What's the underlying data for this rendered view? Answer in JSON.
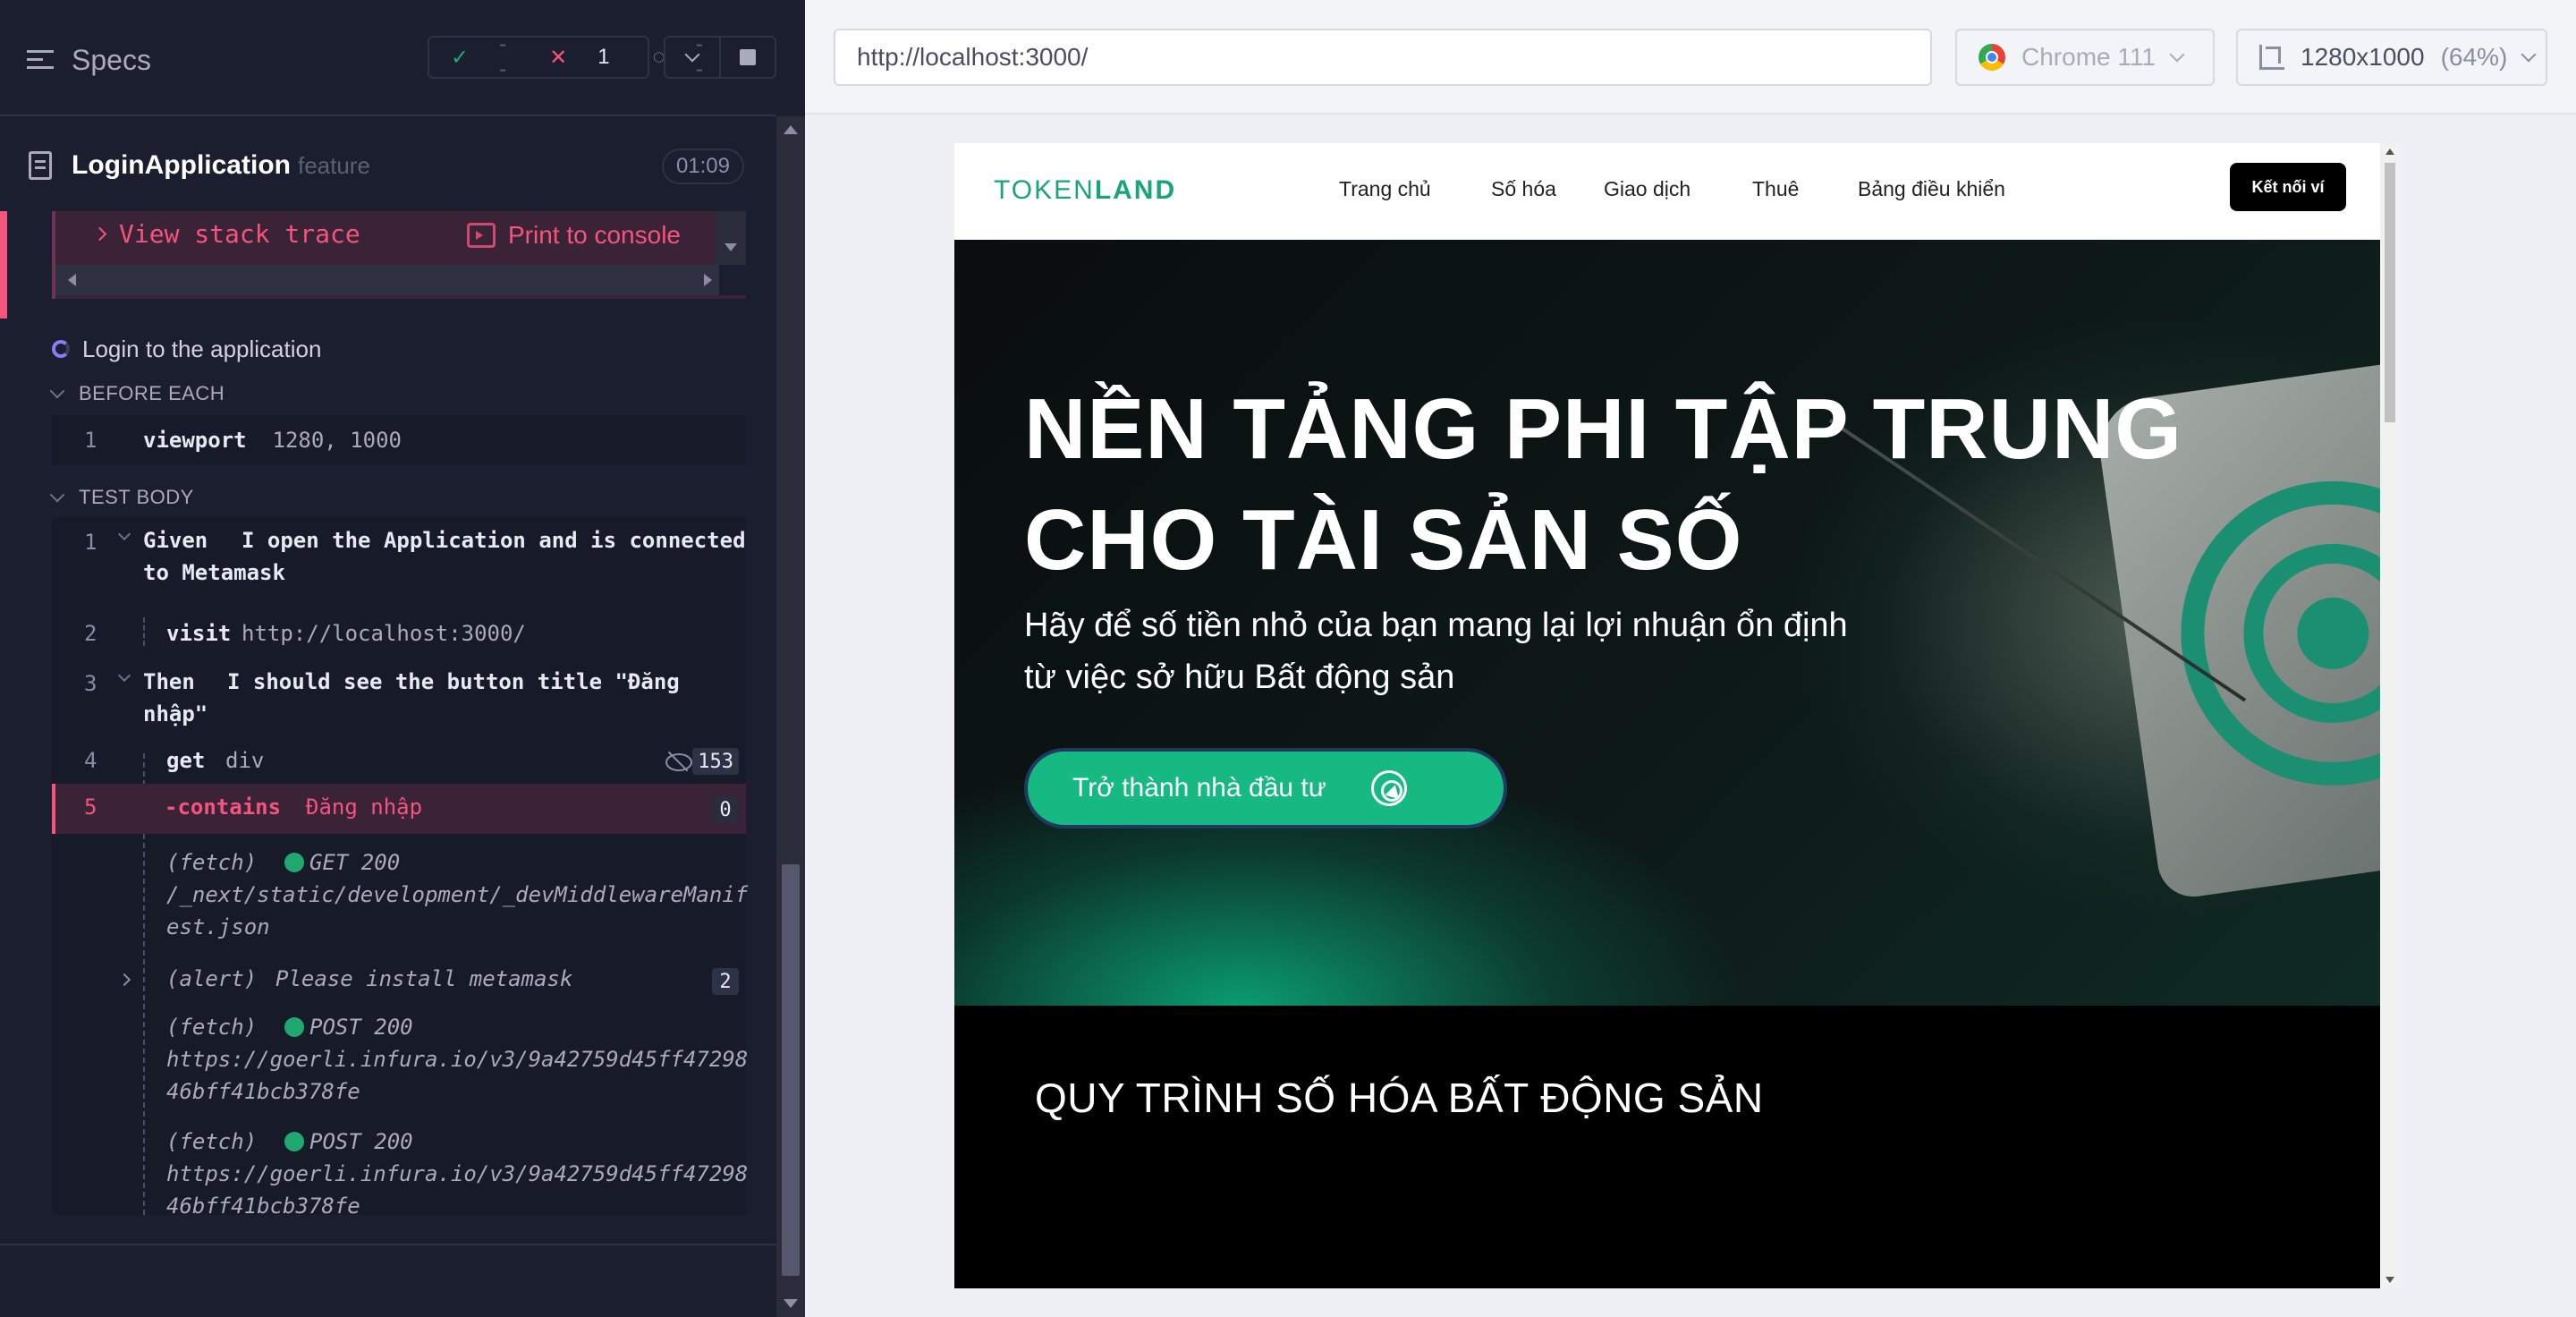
{
  "reporter": {
    "header": {
      "specs_label": "Specs",
      "stats": {
        "passed": "--",
        "failed": "1",
        "pending": "--"
      }
    },
    "file": {
      "name": "LoginApplication",
      "ext": "feature",
      "duration": "01:09"
    },
    "error": {
      "stack_label": "View stack trace",
      "print_label": "Print to console"
    },
    "test": {
      "title": "Login to the application"
    },
    "before_each": {
      "header": "BEFORE EACH",
      "commands": [
        {
          "num": "1",
          "name": "viewport",
          "arg": "1280, 1000"
        }
      ]
    },
    "test_body": {
      "header": "TEST BODY",
      "step1": {
        "num": "1",
        "keyword": "Given",
        "text": "I open the Application and is connected",
        "text2": "to Metamask"
      },
      "step2": {
        "num": "2",
        "name": "visit",
        "arg": "http://localhost:3000/"
      },
      "step3": {
        "num": "3",
        "keyword": "Then",
        "text": "I should see the button title \"Đăng",
        "text2": "nhập\""
      },
      "step4": {
        "num": "4",
        "name": "get",
        "arg": "div",
        "count": "153"
      },
      "step5": {
        "num": "5",
        "name": "-contains",
        "arg": "Đăng nhập",
        "count": "0"
      },
      "log1": {
        "type": "(fetch)",
        "status": "GET 200",
        "url1": "/_next/static/development/_devMiddlewareManif",
        "url2": "est.json"
      },
      "log2": {
        "type": "(alert)",
        "text": "Please install metamask",
        "count": "2"
      },
      "log3": {
        "type": "(fetch)",
        "status": "POST 200",
        "url1": "https://goerli.infura.io/v3/9a42759d45ff47298",
        "url2": "46bff41bcb378fe"
      },
      "log4": {
        "type": "(fetch)",
        "status": "POST 200",
        "url1": "https://goerli.infura.io/v3/9a42759d45ff47298",
        "url2": "46bff41bcb378fe"
      }
    }
  },
  "aut": {
    "url": "http://localhost:3000/",
    "browser": "Chrome 111",
    "viewport": "1280x1000",
    "scale": "(64%)"
  },
  "site": {
    "logo_part1": "TOKEN",
    "logo_part2": "LAND",
    "nav": [
      "Trang chủ",
      "Số hóa",
      "Giao dịch",
      "Thuê",
      "Bảng điều khiển"
    ],
    "connect": "Kết nối ví",
    "hero": {
      "title_line1": "NỀN TẢNG PHI TẬP TRUNG",
      "title_line2": "CHO TÀI SẢN SỐ",
      "sub_line1": "Hãy để số tiền nhỏ của bạn mang lại lợi nhuận ổn định",
      "sub_line2": "từ việc sở hữu Bất động sản",
      "cta": "Trở thành nhà đầu tư"
    },
    "process_title": "QUY TRÌNH SỐ HÓA BẤT ĐỘNG SẢN"
  },
  "colors": {
    "reporter_bg": "#1b1e2e",
    "fail": "#f5547c",
    "pass": "#1fa971",
    "brand_green": "#16b981"
  },
  "icons": [
    "menu-icon",
    "check-icon",
    "x-icon",
    "spinner-icon",
    "chevron-down-icon",
    "stop-icon",
    "document-icon",
    "chevron-right-icon",
    "console-icon",
    "eye-slash-icon",
    "chrome-icon",
    "ruler-icon",
    "cursor-click-icon"
  ]
}
